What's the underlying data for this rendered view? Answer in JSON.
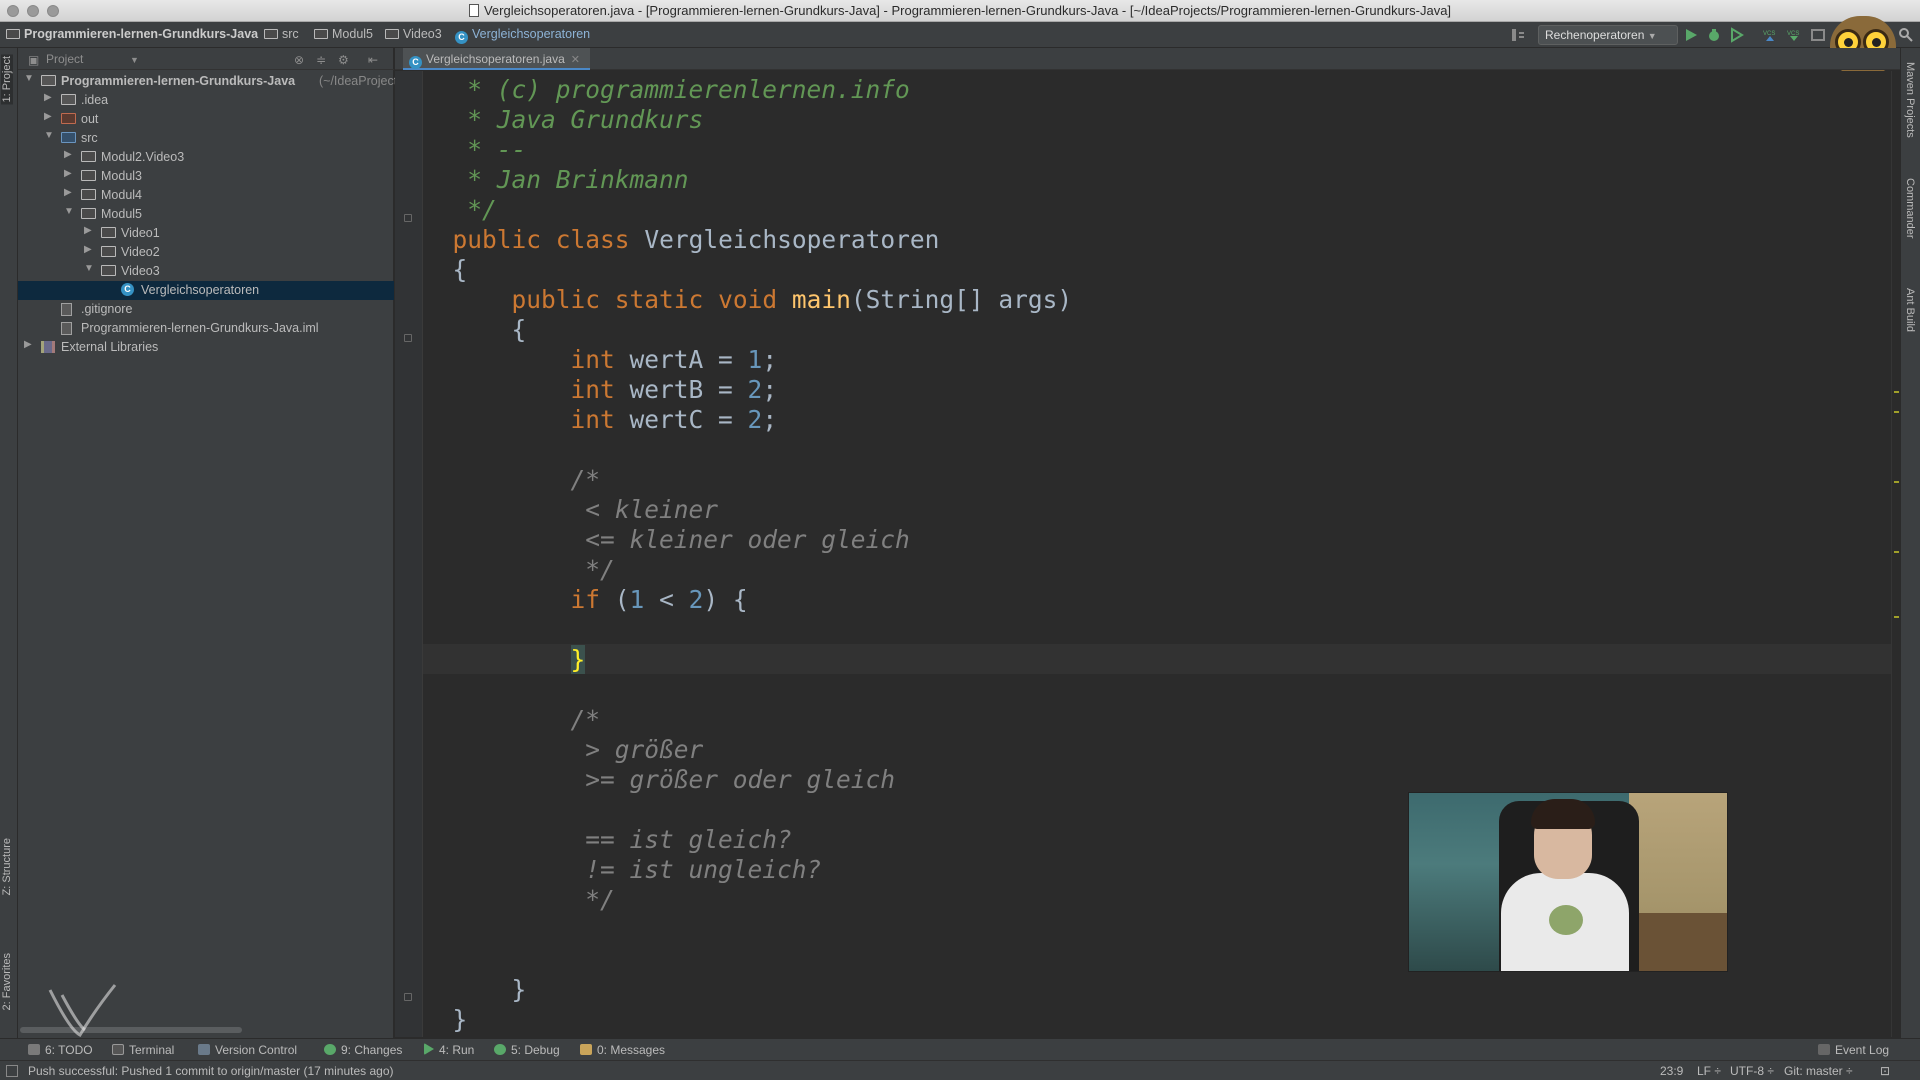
{
  "window": {
    "title": "Vergleichsoperatoren.java - [Programmieren-lernen-Grundkurs-Java] - Programmieren-lernen-Grundkurs-Java - [~/IdeaProjects/Programmieren-lernen-Grundkurs-Java]"
  },
  "breadcrumbs": [
    "Programmieren-lernen-Grundkurs-Java",
    "src",
    "Modul5",
    "Video3",
    "Vergleichsoperatoren"
  ],
  "run_config": "Rechenoperatoren",
  "left_strip": {
    "project": "1: Project",
    "structure": "Z: Structure",
    "favorites": "2: Favorites"
  },
  "right_strip": {
    "maven": "Maven Projects",
    "commander": "Commander",
    "ant": "Ant Build"
  },
  "project_panel": {
    "title": "Project",
    "tree": [
      {
        "label": "Programmieren-lernen-Grundkurs-Java",
        "suffix": "(~/IdeaProjects/Programmieren-lernen-Grundkurs-Java)",
        "depth": 0,
        "arrow": "▼",
        "icon": "dir"
      },
      {
        "label": ".idea",
        "depth": 1,
        "arrow": "▶",
        "icon": "dir"
      },
      {
        "label": "out",
        "depth": 1,
        "arrow": "▶",
        "icon": "dir-red"
      },
      {
        "label": "src",
        "depth": 1,
        "arrow": "▼",
        "icon": "dir-blue"
      },
      {
        "label": "Modul2.Video3",
        "depth": 2,
        "arrow": "▶",
        "icon": "pkg"
      },
      {
        "label": "Modul3",
        "depth": 2,
        "arrow": "▶",
        "icon": "pkg"
      },
      {
        "label": "Modul4",
        "depth": 2,
        "arrow": "▶",
        "icon": "pkg"
      },
      {
        "label": "Modul5",
        "depth": 2,
        "arrow": "▼",
        "icon": "pkg"
      },
      {
        "label": "Video1",
        "depth": 3,
        "arrow": "▶",
        "icon": "pkg"
      },
      {
        "label": "Video2",
        "depth": 3,
        "arrow": "▶",
        "icon": "pkg"
      },
      {
        "label": "Video3",
        "depth": 3,
        "arrow": "▼",
        "icon": "pkg"
      },
      {
        "label": "Vergleichsoperatoren",
        "depth": 4,
        "arrow": "",
        "icon": "class",
        "selected": true
      },
      {
        "label": ".gitignore",
        "depth": 1,
        "arrow": "",
        "icon": "file"
      },
      {
        "label": "Programmieren-lernen-Grundkurs-Java.iml",
        "depth": 1,
        "arrow": "",
        "icon": "file"
      },
      {
        "label": "External Libraries",
        "depth": 0,
        "arrow": "▶",
        "icon": "lib"
      }
    ]
  },
  "editor": {
    "tab": "Vergleichsoperatoren.java",
    "lines": [
      "   * (c) programmierenlernen.info",
      "   * Java Grundkurs",
      "   * --",
      "   * Jan Brinkmann",
      "   */",
      "  public class Vergleichsoperatoren",
      "  {",
      "      public static void main(String[] args)",
      "      {",
      "          int wertA = 1;",
      "          int wertB = 2;",
      "          int wertC = 2;",
      "",
      "          /*",
      "           < kleiner",
      "           <= kleiner oder gleich",
      "           */",
      "          if (1 < 2) {",
      "",
      "          }",
      "",
      "          /*",
      "           > größer",
      "           >= größer oder gleich",
      "",
      "           == ist gleich?",
      "           != ist ungleich?",
      "           */",
      "",
      "",
      "      }",
      "  }"
    ]
  },
  "bottom_tools": [
    "6: TODO",
    "Terminal",
    "Version Control",
    "9: Changes",
    "4: Run",
    "5: Debug",
    "0: Messages"
  ],
  "event_log": "Event Log",
  "status": {
    "message": "Push successful: Pushed 1 commit to origin/master (17 minutes ago)",
    "position": "23:9",
    "line_sep": "LF ÷",
    "encoding": "UTF-8 ÷",
    "vcs": "Git: master ÷"
  }
}
